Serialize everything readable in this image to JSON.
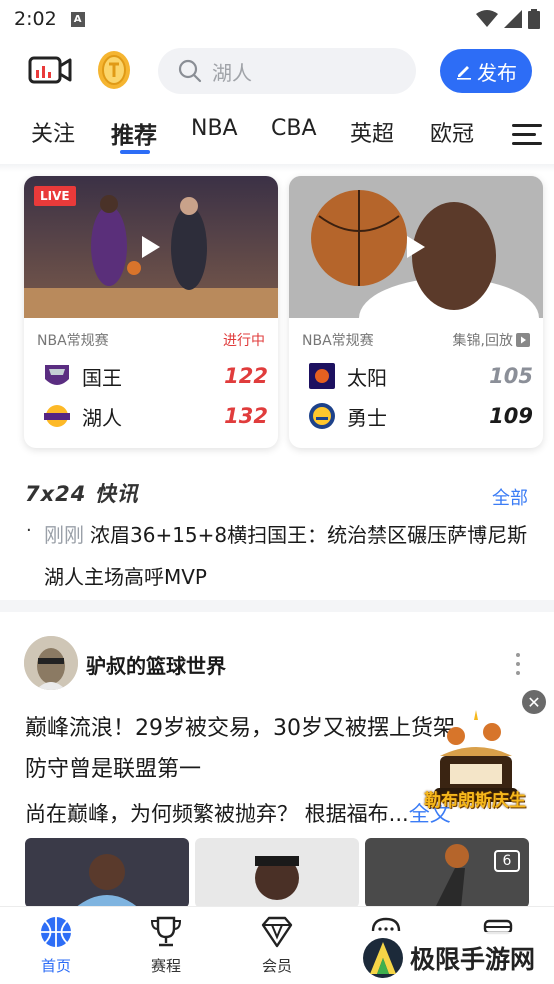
{
  "status_bar": {
    "time": "2:02",
    "notif": "A"
  },
  "header": {
    "search_placeholder": "湖人",
    "post_label": "发布"
  },
  "tabs": [
    {
      "label": "关注"
    },
    {
      "label": "推荐",
      "active": true
    },
    {
      "label": "NBA"
    },
    {
      "label": "CBA"
    },
    {
      "label": "英超"
    },
    {
      "label": "欧冠"
    }
  ],
  "games": [
    {
      "live_badge": "LIVE",
      "league": "NBA常规赛",
      "status": "进行中",
      "home": {
        "name": "国王",
        "score": "122",
        "logo_color": "#5a2d81"
      },
      "away": {
        "name": "湖人",
        "score": "132",
        "logo_color": "#552583"
      }
    },
    {
      "league": "NBA常规赛",
      "status": "集锦,回放",
      "home": {
        "name": "太阳",
        "score": "105",
        "logo_color": "#e56020"
      },
      "away": {
        "name": "勇士",
        "score": "109",
        "logo_color": "#1d428a"
      }
    }
  ],
  "flash": {
    "title": "7x24 快讯",
    "all_label": "全部",
    "time": "刚刚",
    "text": "浓眉36+15+8横扫国王：统治禁区碾压萨博尼斯 湖人主场高呼MVP"
  },
  "post": {
    "author": "驴叔的篮球世界",
    "title_line1": "巅峰流浪！29岁被交易，30岁又被摆上货架",
    "title_line2": "防守曾是联盟第一",
    "excerpt": "尚在巅峰，为何频繁被抛弃？ 根据福布...",
    "excerpt_more": "全文",
    "image_count": "6",
    "float_label": "勒布朗斯庆生",
    "close_label": "✕"
  },
  "bottom_nav": [
    {
      "label": "首页",
      "active": true
    },
    {
      "label": "赛程"
    },
    {
      "label": "会员"
    }
  ],
  "watermark": {
    "text": "极限手游网"
  },
  "colors": {
    "accent": "#2d6df6",
    "live_red": "#e03c3c"
  }
}
